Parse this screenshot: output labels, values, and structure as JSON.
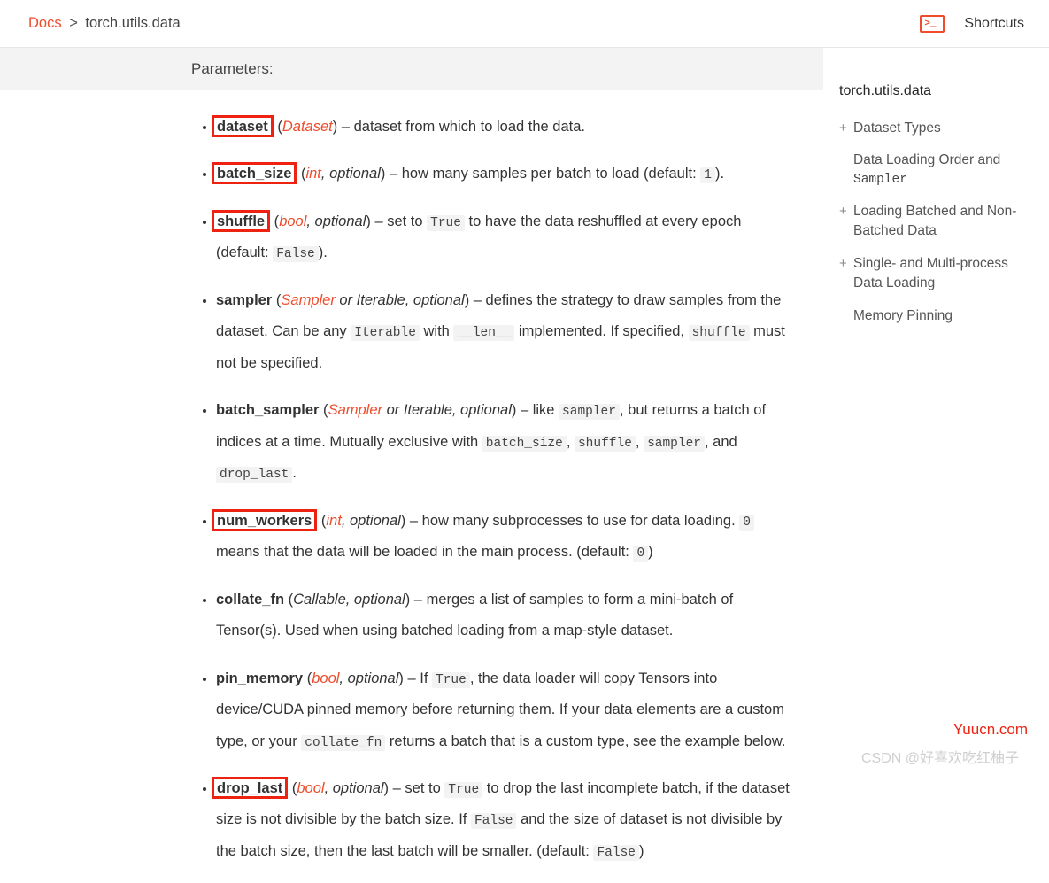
{
  "breadcrumb": {
    "root": "Docs",
    "sep": ">",
    "current": "torch.utils.data"
  },
  "shortcuts_label": "Shortcuts",
  "params_heading": "Parameters:",
  "sidebar": {
    "title": "torch.utils.data",
    "items": [
      {
        "plus": "+",
        "label": "Dataset Types"
      },
      {
        "plus": "",
        "label": "Data Loading Order and",
        "label2": "Sampler"
      },
      {
        "plus": "+",
        "label": "Loading Batched and Non-Batched Data"
      },
      {
        "plus": "+",
        "label": "Single- and Multi-process Data Loading"
      },
      {
        "plus": "",
        "label": "Memory Pinning"
      }
    ]
  },
  "p": {
    "dataset": {
      "name": "dataset",
      "type": "Dataset",
      "desc_after": " – dataset from which to load the data."
    },
    "batch_size": {
      "name": "batch_size",
      "type": "int",
      "opt": ", optional",
      "desc_a": " – how many samples per batch to load (default: ",
      "def": "1",
      "desc_b": ")."
    },
    "shuffle": {
      "name": "shuffle",
      "type": "bool",
      "opt": ", optional",
      "d1": " – set to ",
      "c1": "True",
      "d2": " to have the data reshuffled at every epoch (default: ",
      "c2": "False",
      "d3": ")."
    },
    "sampler": {
      "name": "sampler",
      "type": "Sampler",
      "or": " or Iterable",
      "opt": ", optional",
      "d1": " – defines the strategy to draw samples from the dataset. Can be any ",
      "c1": "Iterable",
      "d2": " with ",
      "c2": "__len__",
      "d3": " implemented. If specified, ",
      "c3": "shuffle",
      "d4": " must not be specified."
    },
    "batch_sampler": {
      "name": "batch_sampler",
      "type": "Sampler",
      "or": " or Iterable",
      "opt": ", optional",
      "d1": " – like ",
      "c1": "sampler",
      "d2": ", but returns a batch of indices at a time. Mutually exclusive with ",
      "c2": "batch_size",
      "d3": ", ",
      "c3": "shuffle",
      "d4": ", ",
      "c4": "sampler",
      "d5": ", and ",
      "c5": "drop_last",
      "d6": "."
    },
    "num_workers": {
      "name": "num_workers",
      "type": "int",
      "opt": ", optional",
      "d1": " – how many subprocesses to use for data loading. ",
      "c1": "0",
      "d2": " means that the data will be loaded in the main process. (default: ",
      "c2": "0",
      "d3": ")"
    },
    "collate_fn": {
      "name": "collate_fn",
      "type_plain": "Callable",
      "opt": ", optional",
      "d1": " – merges a list of samples to form a mini-batch of Tensor(s). Used when using batched loading from a map-style dataset."
    },
    "pin_memory": {
      "name": "pin_memory",
      "type": "bool",
      "opt": ", optional",
      "d1": " – If ",
      "c1": "True",
      "d2": ", the data loader will copy Tensors into device/CUDA pinned memory before returning them. If your data elements are a custom type, or your ",
      "c2": "collate_fn",
      "d3": " returns a batch that is a custom type, see the example below."
    },
    "drop_last": {
      "name": "drop_last",
      "type": "bool",
      "opt": ", optional",
      "d1": " – set to ",
      "c1": "True",
      "d2": " to drop the last incomplete batch, if the dataset size is not divisible by the batch size. If ",
      "c2": "False",
      "d3": " and the size of dataset is not divisible by the batch size, then the last batch will be smaller. (default: ",
      "c3": "False",
      "d4": ")"
    }
  },
  "watermark": {
    "site": "Yuucn.com",
    "csdn": "CSDN @好喜欢吃红柚子"
  }
}
